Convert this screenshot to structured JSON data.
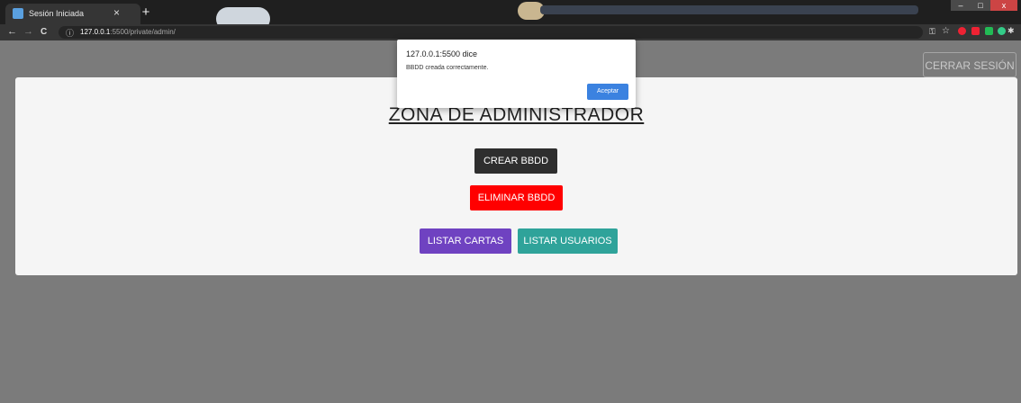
{
  "browser": {
    "tab_title": "Sesión Iniciada",
    "tab_close": "×",
    "new_tab": "+",
    "nav": {
      "back": "←",
      "forward": "→",
      "reload": "C"
    },
    "url_host": "127.0.0.1",
    "url_rest": ":5500/private/admin/",
    "window": {
      "minimize": "–",
      "maximize": "□",
      "close": "x"
    },
    "extension_colors": [
      "#e23",
      "#e23",
      "#2b5",
      "#3c8",
      "#ddd",
      "#c96"
    ]
  },
  "page": {
    "logout_label": "CERRAR SESIÓN",
    "title": "ZONA DE ADMINISTRADOR",
    "buttons": {
      "create_db": "CREAR BBDD",
      "delete_db": "ELIMINAR BBDD",
      "list_cards": "LISTAR CARTAS",
      "list_users": "LISTAR USUARIOS"
    }
  },
  "dialog": {
    "title": "127.0.0.1:5500 dice",
    "message": "BBDD creada correctamente.",
    "accept_label": "Aceptar"
  }
}
